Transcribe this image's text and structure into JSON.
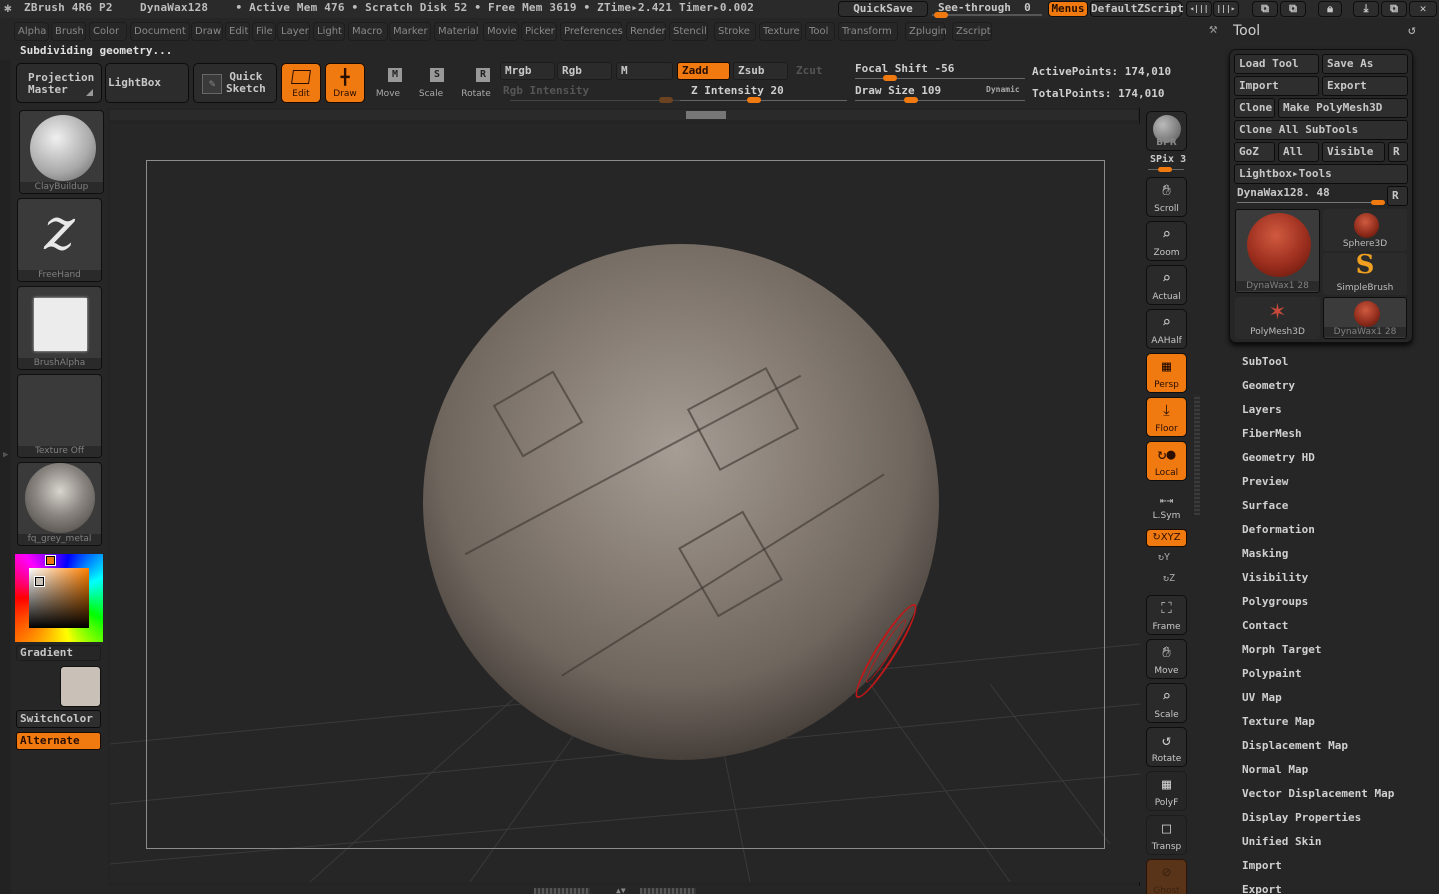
{
  "titlebar": {
    "app": "ZBrush 4R6 P2",
    "document": "DynaWax128",
    "stats": "• Active Mem 476 • Scratch Disk 52 • Free Mem 3619 • ZTime▸2.421  Timer▸0.002",
    "quicksave": "QuickSave",
    "see_through_label": "See-through",
    "see_through_value": "0",
    "see_through_fraction": 0.0,
    "menus": "Menus",
    "default_zscript": "DefaultZScript"
  },
  "menubar": [
    "Alpha",
    "Brush",
    "Color",
    "Document",
    "Draw",
    "Edit",
    "File",
    "Layer",
    "Light",
    "Macro",
    "Marker",
    "Material",
    "Movie",
    "Picker",
    "Preferences",
    "Render",
    "Stencil",
    "Stroke",
    "Texture",
    "Tool",
    "Transform",
    "Zplugin",
    "Zscript"
  ],
  "status_text": "Subdividing geometry...",
  "shelf": {
    "projection_master": [
      "Projection",
      "Master"
    ],
    "lightbox": "LightBox",
    "quick_sketch": [
      "Quick",
      "Sketch"
    ],
    "edit": "Edit",
    "draw": "Draw",
    "move": "Move",
    "scale": "Scale",
    "rotate": "Rotate",
    "mrgb": "Mrgb",
    "rgb": "Rgb",
    "m": "M",
    "zadd": "Zadd",
    "zsub": "Zsub",
    "zcut": "Zcut",
    "rgb_intensity": "Rgb Intensity",
    "z_intensity_label": "Z Intensity",
    "z_intensity": "20",
    "focal_shift_label": "Focal Shift",
    "focal_shift": "-56",
    "draw_size_label": "Draw Size",
    "draw_size": "109",
    "dynamic": "Dynamic",
    "active_points": "ActivePoints: 174,010",
    "total_points": "TotalPoints: 174,010"
  },
  "left": {
    "brush": "ClayBuildup",
    "stroke": "FreeHand",
    "alpha": "BrushAlpha",
    "texture": "Texture Off",
    "material": "fq_grey_metal",
    "gradient": "Gradient",
    "switchcolor": "SwitchColor",
    "alternate": "Alternate",
    "main_color": "#c9c1b8"
  },
  "rightshelf": {
    "bpr": "BPR",
    "spix": "SPix 3",
    "scroll": "Scroll",
    "zoom": "Zoom",
    "actual": "Actual",
    "aahalf": "AAHalf",
    "persp": "Persp",
    "floor": "Floor",
    "local": "Local",
    "lsym": "L.Sym",
    "xyz": "XYZ",
    "y": "Y",
    "z": "Z",
    "frame": "Frame",
    "move": "Move",
    "scale": "Scale",
    "rotate": "Rotate",
    "polyf": "PolyF",
    "transp": "Transp",
    "ghost": "Ghost"
  },
  "tool": {
    "title": "Tool",
    "load_tool": "Load Tool",
    "save_as": "Save As",
    "import": "Import",
    "export": "Export",
    "clone": "Clone",
    "make_polymesh": "Make PolyMesh3D",
    "clone_all": "Clone All SubTools",
    "goz": "GoZ",
    "all": "All",
    "visible": "Visible",
    "r": "R",
    "lightbox_tools": "Lightbox▸Tools",
    "current_tool": "DynaWax128. 48",
    "thumbs": [
      "DynaWax1 28",
      "Sphere3D",
      "SimpleBrush",
      "PolyMesh3D",
      "DynaWax1 28"
    ],
    "subpalettes": [
      "SubTool",
      "Geometry",
      "Layers",
      "FiberMesh",
      "Geometry HD",
      "Preview",
      "Surface",
      "Deformation",
      "Masking",
      "Visibility",
      "Polygroups",
      "Contact",
      "Morph Target",
      "Polypaint",
      "UV Map",
      "Texture Map",
      "Displacement Map",
      "Normal Map",
      "Vector Displacement Map",
      "Display Properties",
      "Unified Skin",
      "Import",
      "Export"
    ]
  },
  "colors": {
    "accent": "#f07a10",
    "background": "#262626"
  }
}
